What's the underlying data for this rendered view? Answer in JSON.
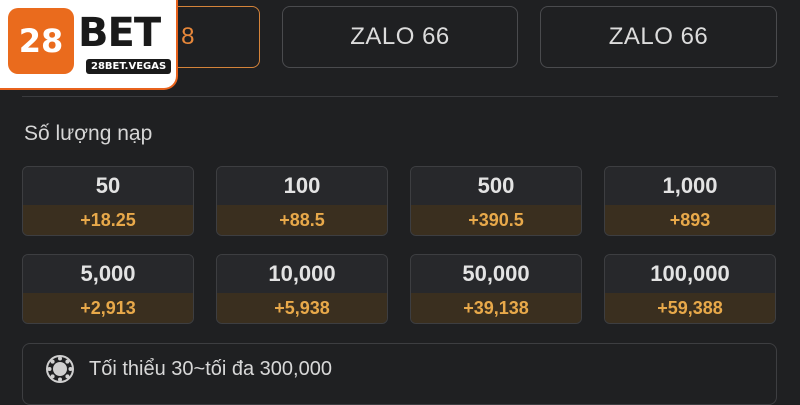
{
  "logo": {
    "badge": "28",
    "word": "BET",
    "domain": "28BET.VEGAS"
  },
  "tabs": [
    {
      "label": "8",
      "active": true
    },
    {
      "label": "ZALO 66",
      "active": false
    },
    {
      "label": "ZALO 66",
      "active": false
    }
  ],
  "section_title": "Số lượng nạp",
  "amounts": [
    {
      "amount": "50",
      "bonus": "+18.25"
    },
    {
      "amount": "100",
      "bonus": "+88.5"
    },
    {
      "amount": "500",
      "bonus": "+390.5"
    },
    {
      "amount": "1,000",
      "bonus": "+893"
    },
    {
      "amount": "5,000",
      "bonus": "+2,913"
    },
    {
      "amount": "10,000",
      "bonus": "+5,938"
    },
    {
      "amount": "50,000",
      "bonus": "+39,138"
    },
    {
      "amount": "100,000",
      "bonus": "+59,388"
    }
  ],
  "limit": {
    "icon": "chip-icon",
    "text": "Tối thiểu 30~tối đa 300,000"
  },
  "colors": {
    "accent": "#e7873a",
    "bonus": "#e8a94a",
    "brand": "#ea6b1d"
  }
}
